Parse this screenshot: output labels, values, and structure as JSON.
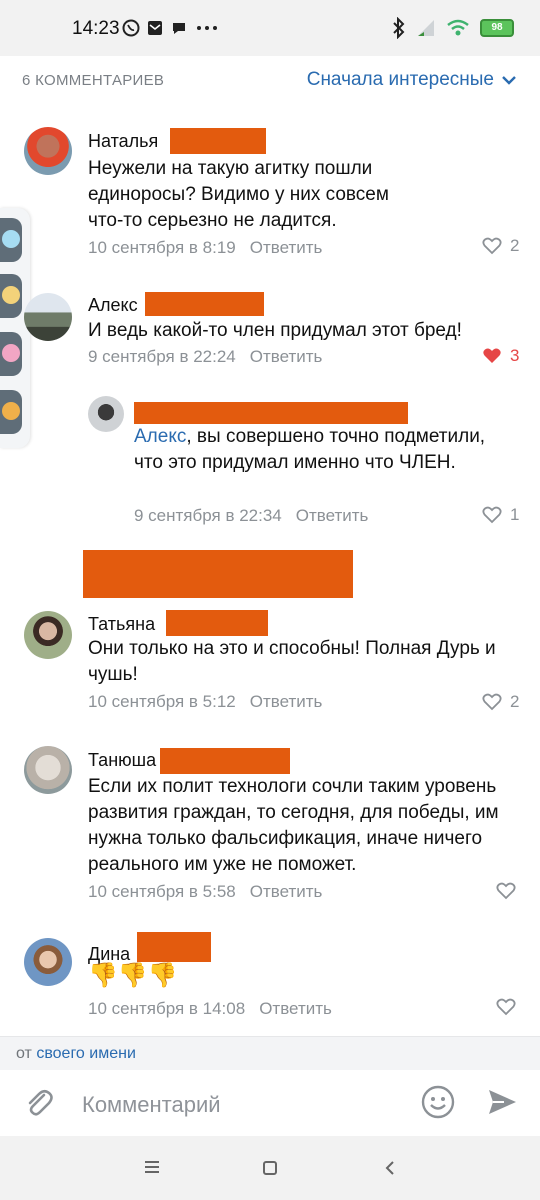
{
  "status_bar": {
    "time": "14:23",
    "battery": "98",
    "icons": [
      "viber-icon",
      "mail-icon",
      "chat-icon",
      "more-dots-icon",
      "bluetooth-icon",
      "signal-icon",
      "wifi-icon",
      "battery-icon"
    ]
  },
  "header": {
    "comments_count": "6 КОММЕНТАРИЕВ",
    "sort_label": "Сначала интересные"
  },
  "comments": [
    {
      "author": "Наталья",
      "text": "Неужели на такую агитку пошли единоросы? Видимо у них совсем что-то серьезно не ладится.",
      "date": "10 сентября в 8:19",
      "reply": "Ответить",
      "likes": "2",
      "liked": false
    },
    {
      "author": "Алекс",
      "text": "И ведь какой-то член придумал этот бред!",
      "date": "9 сентября в 22:24",
      "reply": "Ответить",
      "likes": "3",
      "liked": true
    },
    {
      "author": "",
      "mention": "Алекс",
      "text": ", вы совершено точно подметили, что это придумал именно что ЧЛЕН.",
      "date": "9 сентября в 22:34",
      "reply": "Ответить",
      "likes": "1",
      "liked": false
    },
    {
      "author": "Татьяна",
      "text": "Они только на это и способны! Полная Дурь и чушь!",
      "date": "10 сентября в 5:12",
      "reply": "Ответить",
      "likes": "2",
      "liked": false
    },
    {
      "author": "Танюша",
      "text": "Если их полит технологи сочли таким уровень развития граждан, то сегодня, для победы, им нужна только фальсификация, иначе ничего реального им уже не поможет.",
      "date": "10 сентября в 5:58",
      "reply": "Ответить",
      "likes": "",
      "liked": false
    },
    {
      "author": "Дина",
      "text": "👎👎👎",
      "date": "10 сентября в 14:08",
      "reply": "Ответить",
      "likes": "",
      "liked": false
    }
  ],
  "from_bar": {
    "prefix": "от",
    "link": "своего имени"
  },
  "input": {
    "placeholder": "Комментарий"
  },
  "colors": {
    "accent": "#2a6bb0",
    "redaction": "#e35b0e",
    "like_active": "#e64646",
    "muted": "#8c9196"
  }
}
